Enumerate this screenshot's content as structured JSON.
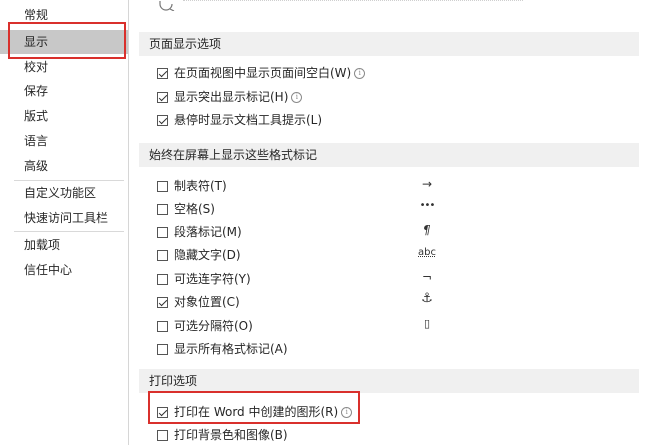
{
  "sidebar": {
    "items": [
      {
        "label": "常规"
      },
      {
        "label": "显示"
      },
      {
        "label": "校对"
      },
      {
        "label": "保存"
      },
      {
        "label": "版式"
      },
      {
        "label": "语言"
      },
      {
        "label": "高级"
      },
      {
        "label": "自定义功能区"
      },
      {
        "label": "快速访问工具栏"
      },
      {
        "label": "加载项"
      },
      {
        "label": "信任中心"
      }
    ]
  },
  "sections": {
    "page_display": {
      "title": "页面显示选项",
      "options": [
        {
          "label": "在页面视图中显示页面间空白(W)",
          "checked": true,
          "info": true
        },
        {
          "label": "显示突出显示标记(H)",
          "checked": true,
          "info": true
        },
        {
          "label": "悬停时显示文档工具提示(L)",
          "checked": true,
          "info": false
        }
      ]
    },
    "formatting_marks": {
      "title": "始终在屏幕上显示这些格式标记",
      "options": [
        {
          "label": "制表符(T)",
          "checked": false,
          "symbol": "→"
        },
        {
          "label": "空格(S)",
          "checked": false,
          "symbol": "•••"
        },
        {
          "label": "段落标记(M)",
          "checked": false,
          "symbol": "¶"
        },
        {
          "label": "隐藏文字(D)",
          "checked": false,
          "symbol": "abc"
        },
        {
          "label": "可选连字符(Y)",
          "checked": false,
          "symbol": "¬"
        },
        {
          "label": "对象位置(C)",
          "checked": true,
          "symbol": "⚓"
        },
        {
          "label": "可选分隔符(O)",
          "checked": false,
          "symbol": "▯"
        },
        {
          "label": "显示所有格式标记(A)",
          "checked": false,
          "symbol": ""
        }
      ]
    },
    "print": {
      "title": "打印选项",
      "options": [
        {
          "label": "打印在 Word 中创建的图形(R)",
          "checked": true,
          "info": true
        },
        {
          "label": "打印背景色和图像(B)",
          "checked": false,
          "info": false
        }
      ]
    }
  },
  "colors": {
    "highlight_box": "#d9302c",
    "selected_nav": "#c8c8c8",
    "section_bg": "#f0f0f0"
  }
}
